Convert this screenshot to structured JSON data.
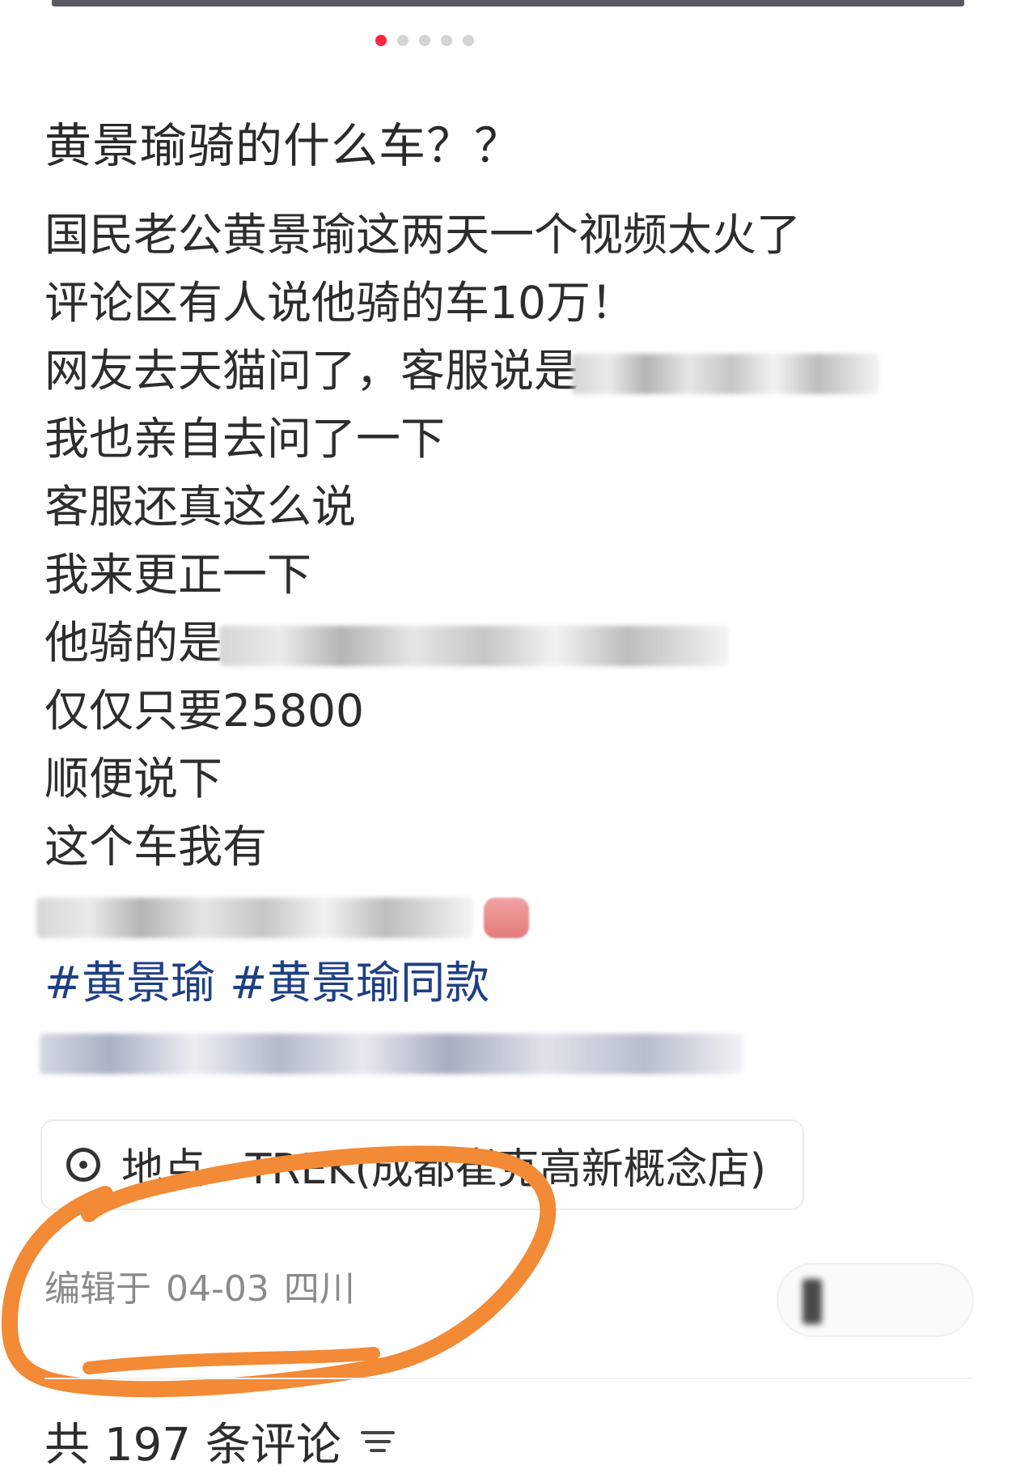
{
  "colors": {
    "accent": "#ff2442",
    "hashtag": "#1e3f84",
    "annotation_stroke": "#f28a36",
    "muted_text": "#8a8a8a"
  },
  "carousel": {
    "dot_count": 5,
    "active_index": 0
  },
  "post": {
    "title": "黄景瑜骑的什么车？？",
    "lines": [
      {
        "text": "国民老公黄景瑜这两天一个视频太火了"
      },
      {
        "text": "评论区有人说他骑的车10万！"
      },
      {
        "text": "网友去天猫问了，客服说是"
      },
      {
        "text": "我也亲自去问了一下"
      },
      {
        "text": "客服还真这么说"
      },
      {
        "text": "我来更正一下"
      },
      {
        "text": "他骑的是"
      },
      {
        "text": "仅仅只要25800"
      },
      {
        "text": "顺便说下"
      },
      {
        "text": "这个车我有"
      }
    ],
    "hashtags": [
      "#黄景瑜",
      "#黄景瑜同款"
    ]
  },
  "location": {
    "icon": "location-pin-icon",
    "text": "地点 · TREK(成都崔克高新概念店)"
  },
  "meta": {
    "edited_prefix": "编辑于",
    "edited_date": "04-03",
    "region": "四川"
  },
  "comments": {
    "prefix": "共",
    "count": "197",
    "suffix": "条评论",
    "sort_icon": "filter-sort-icon"
  }
}
